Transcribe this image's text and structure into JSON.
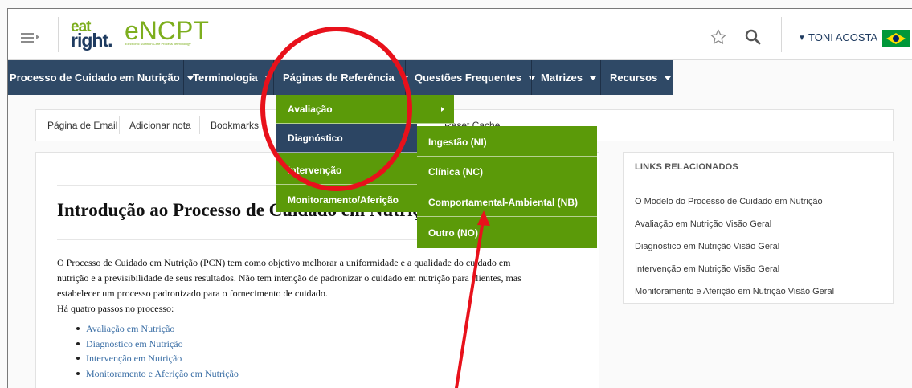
{
  "header": {
    "logo": {
      "eat": "eat",
      "right": "right.",
      "brand": "eNCPT",
      "tagline": "Electronic Nutrition Care Process Terminology"
    },
    "user_name": "TONI ACOSTA",
    "icons": [
      "hamburger-menu-icon",
      "star-icon",
      "search-icon",
      "chevron-down-icon",
      "brazil-flag-icon"
    ]
  },
  "nav": {
    "items": [
      {
        "label": "Processo de Cuidado em Nutrição"
      },
      {
        "label": "Terminologia"
      },
      {
        "label": "Páginas de Referência"
      },
      {
        "label": "Questões Frequentes"
      },
      {
        "label": "Matrizes"
      },
      {
        "label": "Recursos"
      }
    ]
  },
  "toolbar": {
    "items": [
      {
        "label": "Página de Email"
      },
      {
        "label": "Adicionar nota"
      },
      {
        "label": "Bookmarks"
      },
      {
        "label": "Reset Cache"
      }
    ]
  },
  "dropdown": {
    "items": [
      {
        "label": "Avaliação"
      },
      {
        "label": "Diagnóstico"
      },
      {
        "label": "Intervenção"
      },
      {
        "label": "Monitoramento/Aferição"
      }
    ],
    "active_index": 1
  },
  "submenu": {
    "items": [
      {
        "label": "Ingestão (NI)"
      },
      {
        "label": "Clínica (NC)"
      },
      {
        "label": "Comportamental-Ambiental (NB)"
      },
      {
        "label": "Outro (NO)"
      }
    ]
  },
  "main": {
    "title": "Introdução ao Processo de Cuidado em Nutrição",
    "intro_lines": [
      "O Processo de Cuidado em Nutrição (PCN) tem como objetivo melhorar a uniformidade e a qualidade do cuidado em",
      "nutrição e a previsibilidade de seus resultados. Não tem intenção de padronizar o cuidado em nutrição para clientes, mas",
      "estabelecer um processo padronizado para o fornecimento de cuidado.",
      "Há quatro passos no processo:"
    ],
    "steps": [
      "Avaliação em Nutrição",
      "Diagnóstico em Nutrição",
      "Intervenção em Nutrição",
      "Monitoramento e Aferição em Nutrição"
    ]
  },
  "related": {
    "title": "LINKS RELACIONADOS",
    "links": [
      "O Modelo do Processo de Cuidado em Nutrição",
      "Avaliação em Nutrição Visão Geral",
      "Diagnóstico em Nutrição Visão Geral",
      "Intervenção em Nutrição Visão Geral",
      "Monitoramento e Aferição em Nutrição Visão Geral"
    ]
  },
  "colors": {
    "nav_bg": "#2f4966",
    "menu_green": "#5b9a09",
    "menu_active": "#2c4563",
    "brand_green": "#7dae1e",
    "brand_navy": "#1f3b60",
    "annotation_red": "#e8111b",
    "link_blue": "#3a6ea5"
  }
}
